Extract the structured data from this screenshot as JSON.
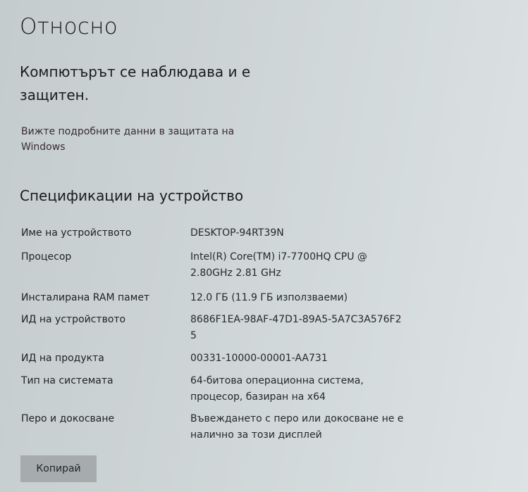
{
  "page": {
    "title": "Относно"
  },
  "protection": {
    "heading": "Компютърът се наблюдава и е защитен.",
    "link": "Вижте подробните данни в защитата на Windows"
  },
  "specs": {
    "heading": "Спецификации на устройство",
    "rows": [
      {
        "label": "Име на устройството",
        "value": "DESKTOP-94RT39N"
      },
      {
        "label": "Процесор",
        "value": "Intel(R) Core(TM) i7-7700HQ CPU @ 2.80GHz 2.81 GHz"
      },
      {
        "label": "Инсталирана RAM памет",
        "value": "12.0 ГБ (11.9 ГБ използваеми)"
      },
      {
        "label": "ИД на устройството",
        "value": "8686F1EA-98AF-47D1-89A5-5A7C3A576F25"
      },
      {
        "label": "ИД на продукта",
        "value": "00331-10000-00001-AA731"
      },
      {
        "label": "Тип на системата",
        "value": "64-битова операционна система, процесор, базиран на x64"
      },
      {
        "label": "Перо и докосване",
        "value": "Въвеждането с перо или докосване не е налично за този дисплей"
      }
    ]
  },
  "actions": {
    "copy_label": "Копирай"
  }
}
